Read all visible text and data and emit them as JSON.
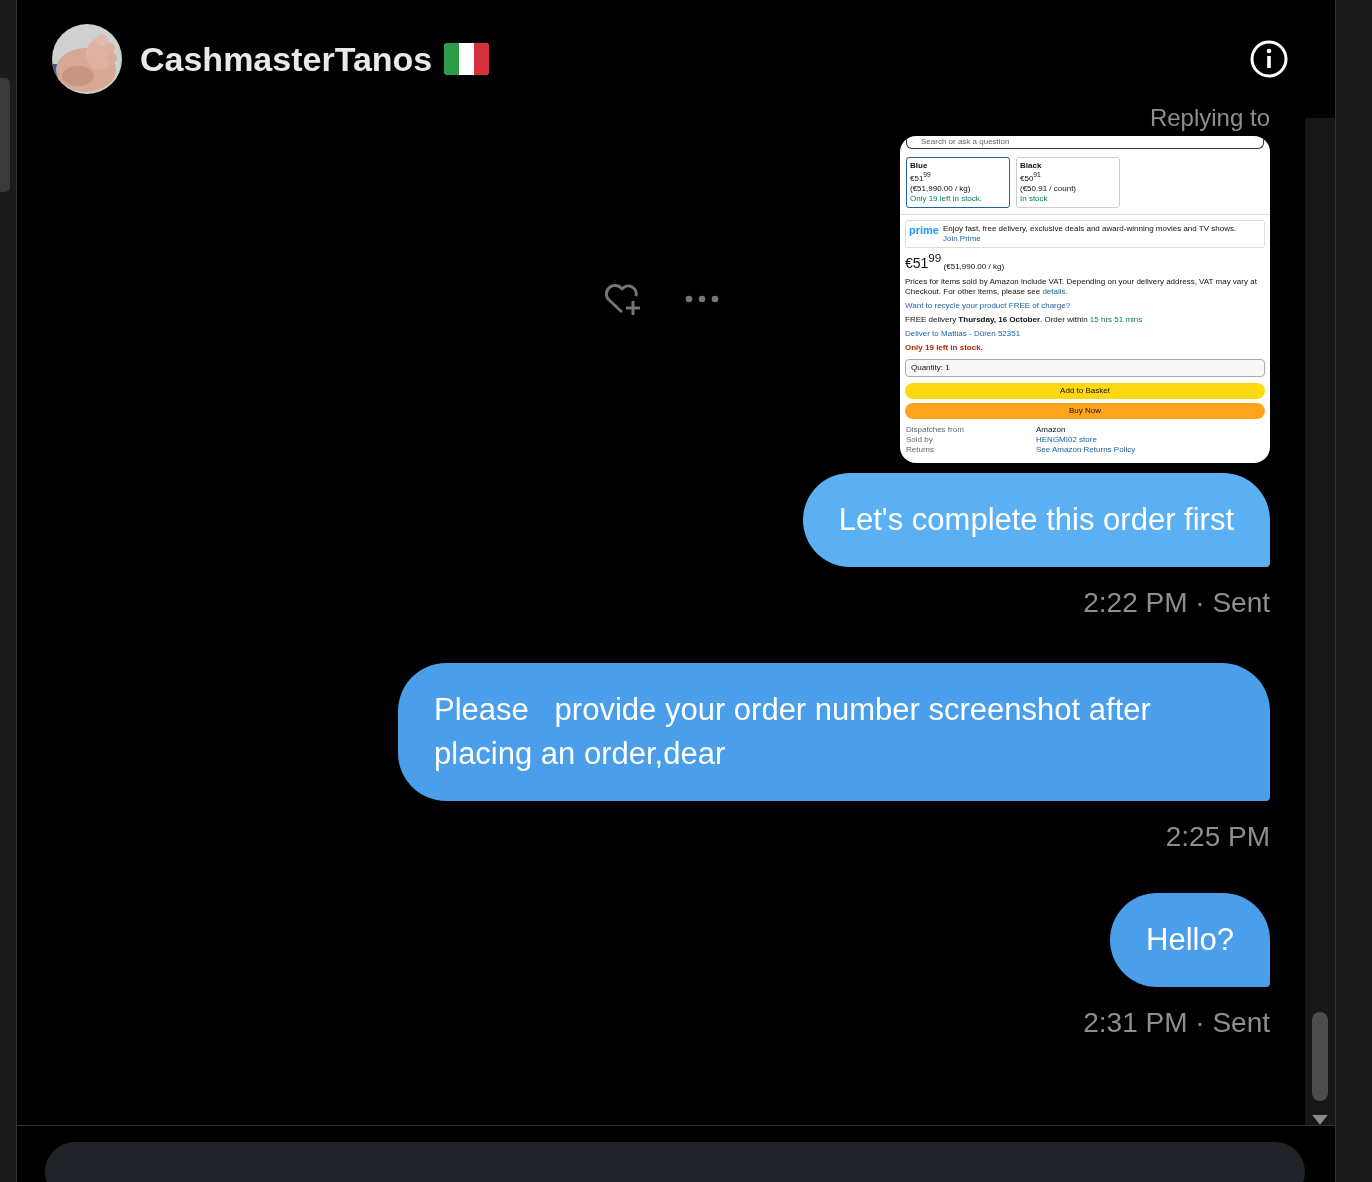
{
  "header": {
    "name": "CashmasterTanos"
  },
  "attachment": {
    "reply_label": "Replying to",
    "screenshot": {
      "search_placeholder": "Search or ask a question",
      "variants": [
        {
          "name": "Blue",
          "price": "€51$^{99}$",
          "unit": "(€51,990.00 / kg)",
          "stock": "Only 19 left in stock.",
          "selected": true
        },
        {
          "name": "Black",
          "price": "€50$^{91}$",
          "unit": "(€50.91 / count)",
          "stock": "In stock",
          "selected": false
        }
      ],
      "prime_logo": "prime",
      "prime_text": "Enjoy fast, free delivery, exclusive deals and award-winning movies and TV shows.",
      "prime_link": "Join Prime",
      "price": "€51$^{99}$",
      "price_unit": "(€51,990.00 / kg)",
      "vat_text": "Prices for items sold by Amazon include VAT. Depending on your delivery address, VAT may vary at Checkout. For other items, please see",
      "vat_link": "details.",
      "recycle_link": "Want to recycle your product FREE of charge?",
      "delivery_text": "FREE delivery **Thursday, 16 October**. Order within",
      "delivery_time": "15 hrs 51 mins",
      "deliver_to": "Deliver to Mattias - Düren 52351",
      "stock_warning": "Only 19 left in stock.",
      "quantity": "Quantity: 1",
      "add_button": "Add to Basket",
      "buy_button": "Buy Now",
      "details": [
        {
          "label": "Dispatches from",
          "value": "Amazon"
        },
        {
          "label": "Sold by",
          "value": "HENGMI02 store"
        },
        {
          "label": "Returns",
          "value": "See Amazon Returns Policy"
        }
      ]
    }
  },
  "messages": [
    {
      "text": "Let's complete this order first",
      "meta": "2:22 PM · Sent"
    },
    {
      "text": "Please   provide your order number screenshot after placing an order,dear",
      "meta": "2:25 PM"
    },
    {
      "text": "Hello?",
      "meta": "2:31 PM · Sent"
    }
  ]
}
